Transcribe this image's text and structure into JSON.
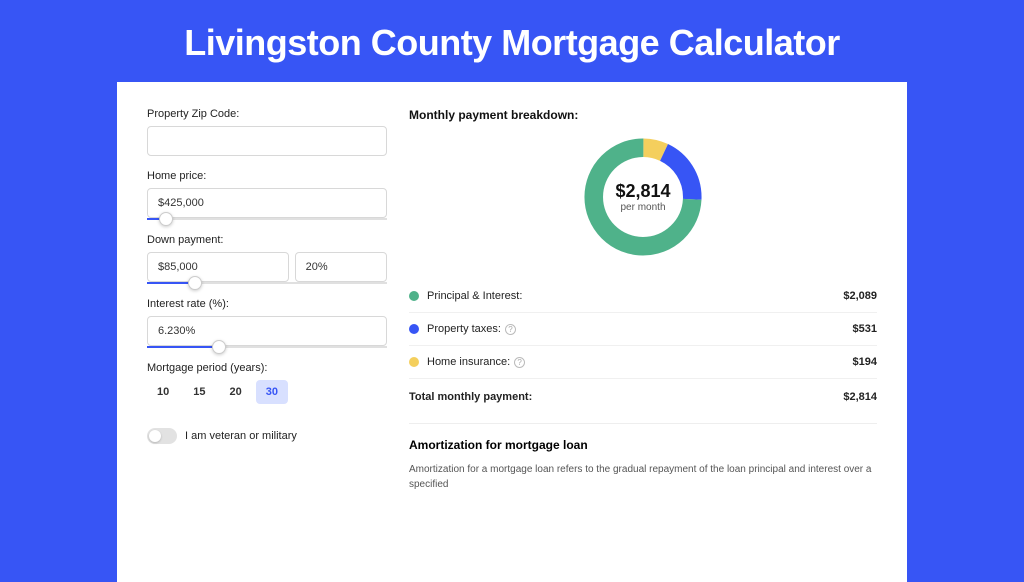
{
  "title": "Livingston County Mortgage Calculator",
  "form": {
    "zip_label": "Property Zip Code:",
    "zip_value": "",
    "home_price_label": "Home price:",
    "home_price_value": "$425,000",
    "home_price_slider_pct": 8,
    "down_payment_label": "Down payment:",
    "down_payment_value": "$85,000",
    "down_payment_pct_value": "20%",
    "down_payment_slider_pct": 20,
    "interest_label": "Interest rate (%):",
    "interest_value": "6.230%",
    "interest_slider_pct": 30,
    "period_label": "Mortgage period (years):",
    "period_options": [
      "10",
      "15",
      "20",
      "30"
    ],
    "period_active": "30",
    "veteran_label": "I am veteran or military"
  },
  "breakdown": {
    "title": "Monthly payment breakdown:",
    "total_amount": "$2,814",
    "total_sub": "per month",
    "items": [
      {
        "label": "Principal & Interest:",
        "value": "$2,089",
        "color": "#4fb28a",
        "has_info": false
      },
      {
        "label": "Property taxes:",
        "value": "$531",
        "color": "#3755f5",
        "has_info": true
      },
      {
        "label": "Home insurance:",
        "value": "$194",
        "color": "#f4cf5d",
        "has_info": true
      }
    ],
    "total_row_label": "Total monthly payment:",
    "total_row_value": "$2,814"
  },
  "chart_data": {
    "type": "pie",
    "title": "Monthly payment breakdown",
    "categories": [
      "Principal & Interest",
      "Property taxes",
      "Home insurance"
    ],
    "values": [
      2089,
      531,
      194
    ],
    "colors": [
      "#4fb28a",
      "#3755f5",
      "#f4cf5d"
    ],
    "center_label": "$2,814",
    "center_sublabel": "per month"
  },
  "amortization": {
    "title": "Amortization for mortgage loan",
    "text": "Amortization for a mortgage loan refers to the gradual repayment of the loan principal and interest over a specified"
  }
}
